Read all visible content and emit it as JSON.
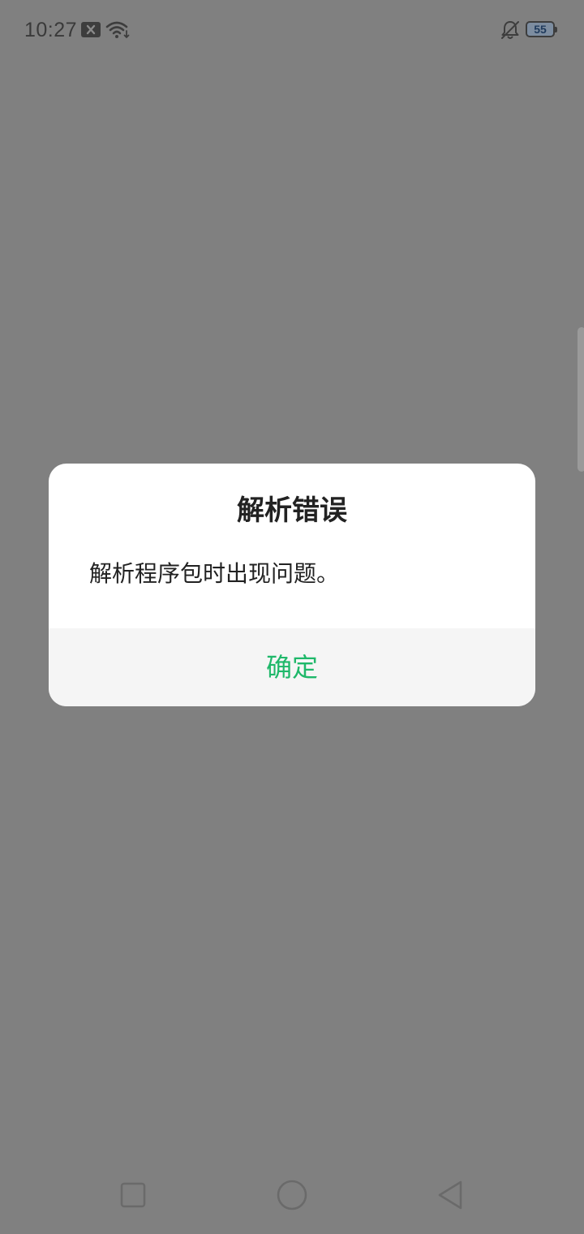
{
  "status_bar": {
    "time": "10:27",
    "battery_level": "55",
    "icons": [
      "sim-off-icon",
      "wifi-icon",
      "bell-off-icon",
      "battery-icon"
    ]
  },
  "dialog": {
    "title": "解析错误",
    "message": "解析程序包时出现问题。",
    "confirm_label": "确定"
  },
  "nav_bar": {
    "icons": [
      "recents-icon",
      "home-icon",
      "back-icon"
    ]
  },
  "colors": {
    "scrim": "#808080",
    "dialog_background": "#ffffff",
    "action_background": "#f5f5f5",
    "accent": "#1fb86a",
    "text": "#222222"
  }
}
